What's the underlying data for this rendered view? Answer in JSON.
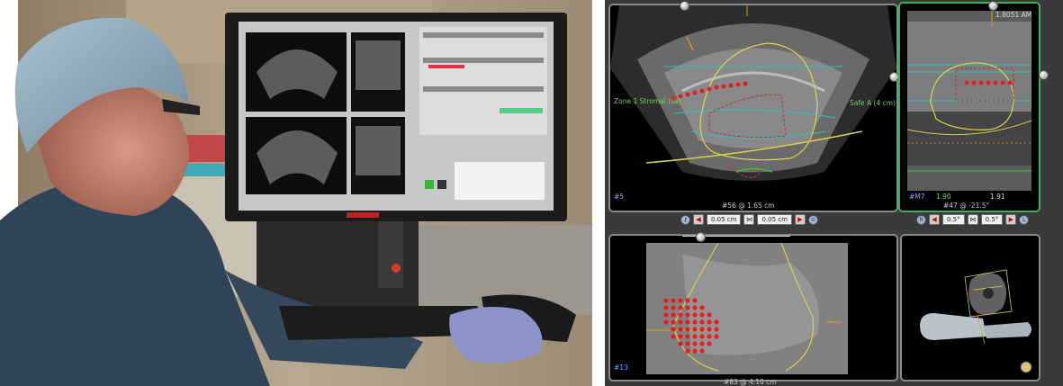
{
  "accent_colors": {
    "active_pane_border": "#3bb54a",
    "prostate_contour": "#d8d24a",
    "target_points": "#e02020",
    "zone_lines": "#2fbfbf"
  },
  "panes": {
    "axial": {
      "zone_left": "Zone 1 Stromal (sa)",
      "zone_right": "Safe A (4 cm)",
      "corner_id": "#5",
      "caption": "#56 @ 1.65 cm",
      "step_left": "0.05 cm",
      "step_right": "0.05 cm"
    },
    "sagittal": {
      "top_label": "1.8051 AM",
      "corner_id": "#M7",
      "reading_left": "1.90",
      "reading_right": "1.91",
      "caption": "#47 @ -21.5°",
      "step_left": "0.5°",
      "step_right": "0.5°"
    },
    "coronal": {
      "corner_id": "#13",
      "caption": "#83 @ 4.10 cm"
    },
    "model3d": {}
  },
  "icons": [
    "step-back-icon",
    "step-forward-icon",
    "lock-icon",
    "link-icon",
    "target-dot-icon",
    "probe-icon"
  ]
}
